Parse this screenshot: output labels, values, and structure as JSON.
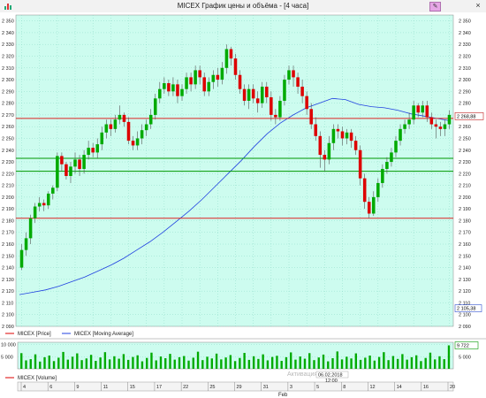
{
  "window": {
    "title": "MICEX График цены и объёма - [4 часа]",
    "close_label": "×",
    "pin_label": "✎"
  },
  "colors": {
    "bg": "#cdfcef",
    "grid": "#8fdcc8",
    "up": "#00aa00",
    "down": "#dd0000",
    "ma": "#2040e0",
    "hline_red": "#dd2222",
    "hline_green": "#009900",
    "volume": "#00aa00"
  },
  "price_axis": {
    "ticks": [
      "2 350",
      "2 340",
      "2 330",
      "2 320",
      "2 310",
      "2 300",
      "2 290",
      "2 280",
      "2 270",
      "2 260",
      "2 250",
      "2 240",
      "2 230",
      "2 220",
      "2 210",
      "2 200",
      "2 190",
      "2 180",
      "2 170",
      "2 160",
      "2 150",
      "2 140",
      "2 130",
      "2 120",
      "2 110",
      "2 100",
      "2 090"
    ],
    "last_price_label": "2 268,88",
    "ma_value_label": "2 105,38"
  },
  "legend": {
    "price": "MICEX [Price]",
    "ma": "MICEX [Moving Average]"
  },
  "volume_panel": {
    "label": "MICEX [Volume]",
    "ticks": [
      "10 000",
      "5 000"
    ],
    "value_label": "9 722",
    "watermark": "Активация Windows"
  },
  "time_axis": {
    "labels": [
      "4",
      "6",
      "9",
      "11",
      "15",
      "17",
      "22",
      "25",
      "29",
      "31",
      "3",
      "5",
      "8",
      "12",
      "14",
      "16",
      "20"
    ],
    "month_label": "Feb",
    "cursor_date": "06.02.2018",
    "cursor_time": "12:00"
  },
  "chart_data": {
    "type": "candlestick",
    "ylim": [
      2090,
      2355
    ],
    "horizontal_lines": [
      {
        "value": 2267,
        "color": "red"
      },
      {
        "value": 2233,
        "color": "green"
      },
      {
        "value": 2222,
        "color": "green"
      },
      {
        "value": 2182,
        "color": "red"
      }
    ],
    "candles": [
      [
        2140,
        2155,
        2138,
        2160
      ],
      [
        2155,
        2165,
        2150,
        2170
      ],
      [
        2165,
        2182,
        2160,
        2185
      ],
      [
        2182,
        2192,
        2178,
        2195
      ],
      [
        2192,
        2195,
        2188,
        2200
      ],
      [
        2195,
        2193,
        2188,
        2198
      ],
      [
        2193,
        2203,
        2190,
        2205
      ],
      [
        2203,
        2208,
        2198,
        2210
      ],
      [
        2208,
        2235,
        2205,
        2238
      ],
      [
        2235,
        2228,
        2222,
        2238
      ],
      [
        2228,
        2218,
        2215,
        2230
      ],
      [
        2218,
        2226,
        2212,
        2230
      ],
      [
        2226,
        2232,
        2220,
        2238
      ],
      [
        2232,
        2224,
        2218,
        2236
      ],
      [
        2224,
        2236,
        2220,
        2240
      ],
      [
        2236,
        2242,
        2232,
        2248
      ],
      [
        2242,
        2238,
        2234,
        2246
      ],
      [
        2238,
        2245,
        2233,
        2250
      ],
      [
        2245,
        2255,
        2240,
        2260
      ],
      [
        2255,
        2262,
        2250,
        2266
      ],
      [
        2262,
        2258,
        2252,
        2266
      ],
      [
        2258,
        2266,
        2255,
        2270
      ],
      [
        2266,
        2270,
        2262,
        2278
      ],
      [
        2270,
        2264,
        2260,
        2272
      ],
      [
        2264,
        2248,
        2245,
        2268
      ],
      [
        2248,
        2244,
        2240,
        2252
      ],
      [
        2244,
        2250,
        2240,
        2256
      ],
      [
        2250,
        2257,
        2245,
        2262
      ],
      [
        2257,
        2262,
        2252,
        2266
      ],
      [
        2262,
        2270,
        2258,
        2275
      ],
      [
        2270,
        2284,
        2266,
        2288
      ],
      [
        2284,
        2292,
        2280,
        2298
      ],
      [
        2292,
        2297,
        2288,
        2302
      ],
      [
        2297,
        2290,
        2286,
        2300
      ],
      [
        2290,
        2296,
        2286,
        2302
      ],
      [
        2296,
        2286,
        2280,
        2300
      ],
      [
        2286,
        2292,
        2282,
        2296
      ],
      [
        2292,
        2302,
        2288,
        2306
      ],
      [
        2302,
        2296,
        2290,
        2306
      ],
      [
        2296,
        2308,
        2292,
        2312
      ],
      [
        2308,
        2302,
        2296,
        2312
      ],
      [
        2302,
        2290,
        2286,
        2306
      ],
      [
        2290,
        2298,
        2286,
        2302
      ],
      [
        2298,
        2304,
        2292,
        2308
      ],
      [
        2304,
        2300,
        2294,
        2310
      ],
      [
        2300,
        2310,
        2296,
        2315
      ],
      [
        2310,
        2326,
        2305,
        2330
      ],
      [
        2326,
        2318,
        2312,
        2328
      ],
      [
        2318,
        2304,
        2300,
        2322
      ],
      [
        2304,
        2292,
        2288,
        2308
      ],
      [
        2292,
        2282,
        2278,
        2296
      ],
      [
        2282,
        2292,
        2275,
        2296
      ],
      [
        2292,
        2284,
        2280,
        2296
      ],
      [
        2284,
        2280,
        2272,
        2290
      ],
      [
        2280,
        2294,
        2276,
        2298
      ],
      [
        2294,
        2285,
        2280,
        2298
      ],
      [
        2285,
        2270,
        2265,
        2290
      ],
      [
        2270,
        2268,
        2262,
        2275
      ],
      [
        2268,
        2282,
        2265,
        2286
      ],
      [
        2282,
        2300,
        2278,
        2304
      ],
      [
        2300,
        2308,
        2296,
        2312
      ],
      [
        2308,
        2302,
        2294,
        2312
      ],
      [
        2302,
        2294,
        2288,
        2306
      ],
      [
        2294,
        2286,
        2280,
        2300
      ],
      [
        2286,
        2275,
        2270,
        2290
      ],
      [
        2275,
        2262,
        2258,
        2280
      ],
      [
        2262,
        2252,
        2248,
        2268
      ],
      [
        2252,
        2236,
        2225,
        2256
      ],
      [
        2236,
        2232,
        2222,
        2240
      ],
      [
        2232,
        2246,
        2228,
        2252
      ],
      [
        2246,
        2258,
        2240,
        2262
      ],
      [
        2258,
        2256,
        2250,
        2262
      ],
      [
        2256,
        2250,
        2244,
        2260
      ],
      [
        2250,
        2255,
        2245,
        2258
      ],
      [
        2255,
        2248,
        2242,
        2258
      ],
      [
        2248,
        2240,
        2236,
        2252
      ],
      [
        2240,
        2216,
        2210,
        2244
      ],
      [
        2216,
        2196,
        2190,
        2220
      ],
      [
        2196,
        2186,
        2182,
        2200
      ],
      [
        2186,
        2200,
        2184,
        2205
      ],
      [
        2200,
        2212,
        2196,
        2216
      ],
      [
        2212,
        2224,
        2208,
        2228
      ],
      [
        2224,
        2230,
        2220,
        2234
      ],
      [
        2230,
        2238,
        2226,
        2242
      ],
      [
        2238,
        2248,
        2234,
        2252
      ],
      [
        2248,
        2258,
        2244,
        2262
      ],
      [
        2258,
        2262,
        2254,
        2266
      ],
      [
        2262,
        2266,
        2258,
        2272
      ],
      [
        2266,
        2278,
        2262,
        2282
      ],
      [
        2278,
        2272,
        2268,
        2280
      ],
      [
        2272,
        2278,
        2268,
        2282
      ],
      [
        2278,
        2268,
        2264,
        2282
      ],
      [
        2268,
        2262,
        2258,
        2272
      ],
      [
        2262,
        2260,
        2250,
        2266
      ],
      [
        2260,
        2258,
        2252,
        2264
      ],
      [
        2258,
        2262,
        2252,
        2266
      ],
      [
        2262,
        2270,
        2258,
        2274
      ]
    ],
    "moving_average": [
      2117,
      2119,
      2121,
      2124,
      2128,
      2132,
      2137,
      2142,
      2148,
      2155,
      2162,
      2170,
      2179,
      2188,
      2198,
      2209,
      2220,
      2231,
      2243,
      2254,
      2263,
      2270,
      2276,
      2280,
      2284,
      2283,
      2279,
      2277,
      2276,
      2274,
      2271,
      2269,
      2267,
      2265
    ],
    "volume": [
      6500,
      3500,
      4000,
      6000,
      3000,
      4800,
      5500,
      3200,
      4600,
      7000,
      3800,
      5000,
      6400,
      3600,
      4300,
      5800,
      3300,
      4700,
      6900,
      3900,
      5200,
      4200,
      6100,
      3700,
      4900,
      5600,
      3100,
      4500,
      6700,
      3500,
      5100,
      4400,
      6200,
      3800,
      4800,
      5300,
      3400,
      4600,
      7100,
      3600,
      5000,
      4300,
      6300,
      3900,
      4700,
      5700,
      3200,
      4500,
      6600,
      3700,
      5200,
      4100,
      6000,
      3500,
      4900,
      5400,
      3300,
      4800,
      6800,
      3800,
      5100,
      4200,
      6500,
      3600,
      4700,
      5900,
      3100,
      4400,
      7200,
      3900,
      5000,
      4300,
      6400,
      3700,
      4600,
      5500,
      3400,
      4900,
      6900,
      3600,
      5300,
      4100,
      6100,
      3800,
      4800,
      5600,
      3200,
      4500,
      6700,
      3900,
      5200,
      4000,
      9722
    ]
  }
}
